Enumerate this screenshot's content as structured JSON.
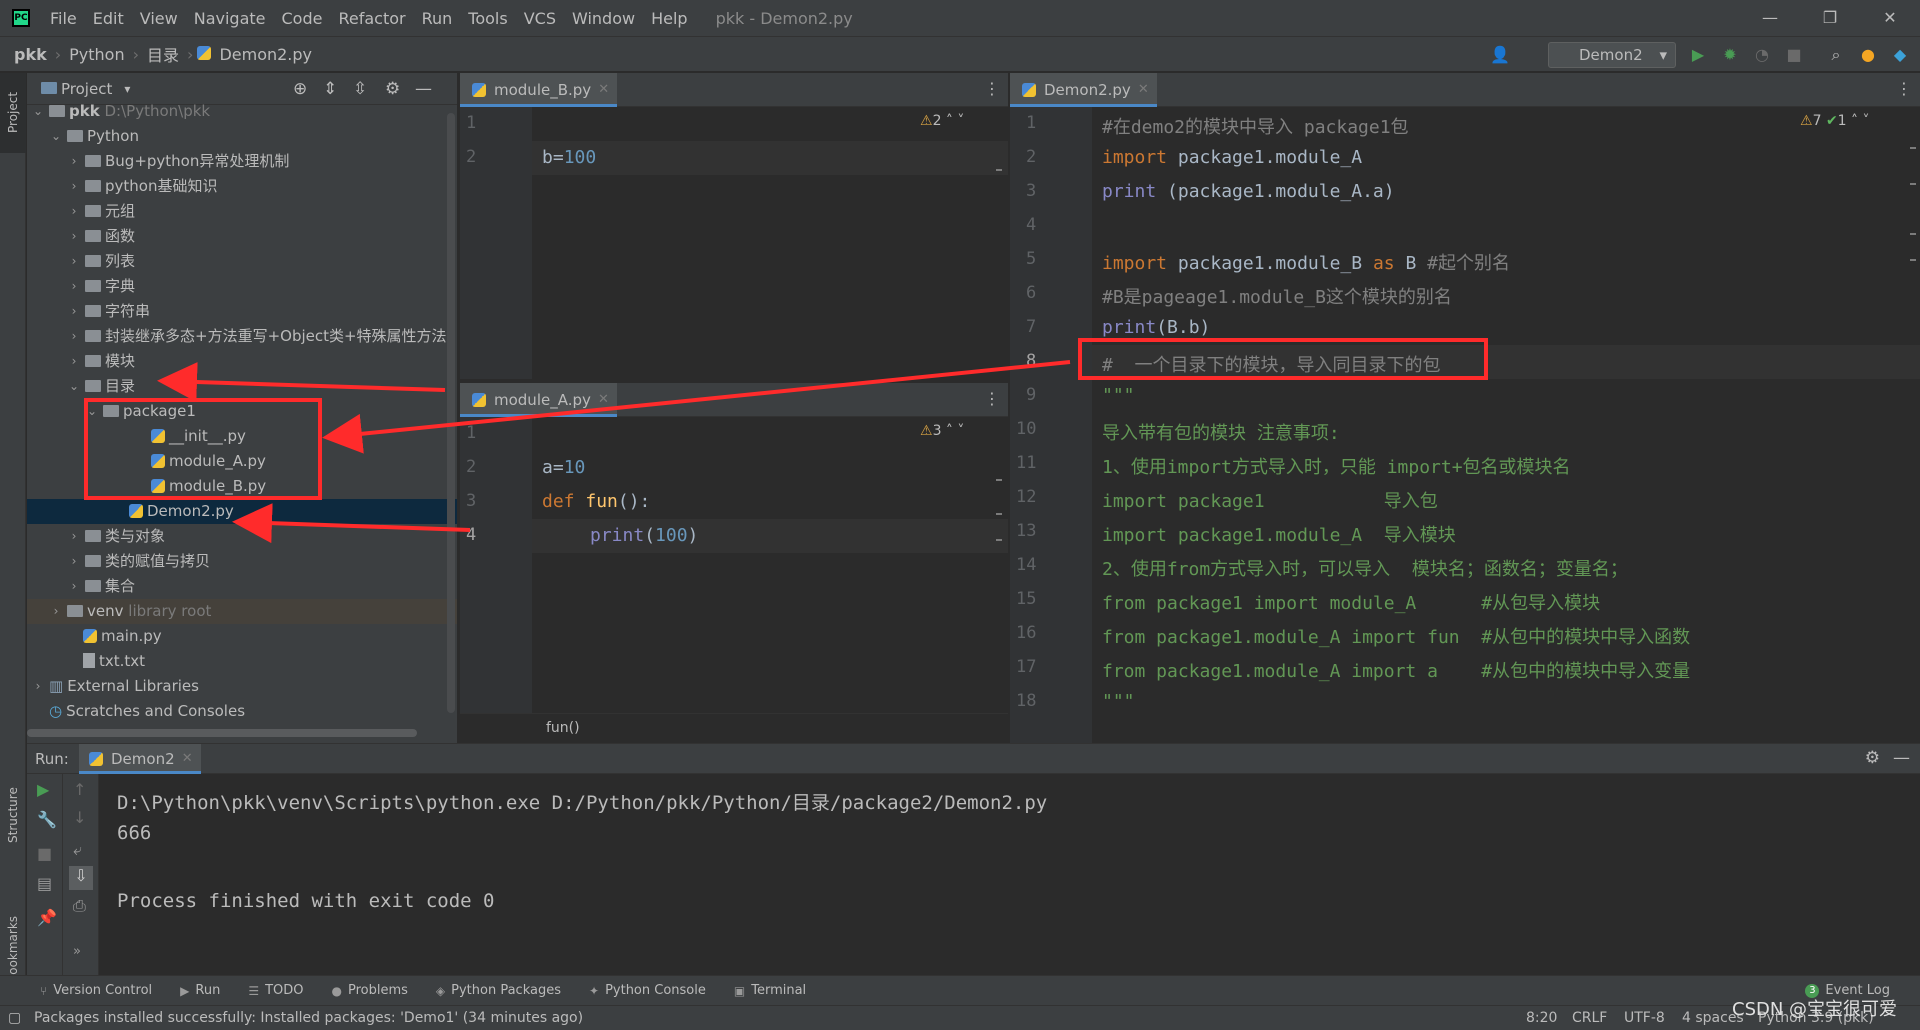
{
  "window": {
    "menu": [
      "File",
      "Edit",
      "View",
      "Navigate",
      "Code",
      "Refactor",
      "Run",
      "Tools",
      "VCS",
      "Window",
      "Help"
    ],
    "title": "pkk - Demon2.py",
    "controls": {
      "minimize": "—",
      "restore": "❐",
      "close": "✕"
    }
  },
  "navbar": {
    "crumbs": [
      "pkk",
      "Python",
      "目录",
      "Demon2.py"
    ],
    "run_config": "Demon2"
  },
  "leftstrip": {
    "project": "Project",
    "structure": "Structure",
    "bookmarks": "Bookmarks"
  },
  "project": {
    "title": "Project",
    "rows": [
      {
        "label": "pkk",
        "extra": "D:\\Python\\pkk"
      },
      {
        "label": "Python"
      },
      {
        "label": "Bug+python异常处理机制"
      },
      {
        "label": "python基础知识"
      },
      {
        "label": "元组"
      },
      {
        "label": "函数"
      },
      {
        "label": "列表"
      },
      {
        "label": "字典"
      },
      {
        "label": "字符串"
      },
      {
        "label": "封装继承多态+方法重写+Object类+特殊属性方法"
      },
      {
        "label": "模块"
      },
      {
        "label": "目录"
      },
      {
        "label": "package1"
      },
      {
        "label": "__init__.py"
      },
      {
        "label": "module_A.py"
      },
      {
        "label": "module_B.py"
      },
      {
        "label": "Demon2.py"
      },
      {
        "label": "类与对象"
      },
      {
        "label": "类的赋值与拷贝"
      },
      {
        "label": "集合"
      },
      {
        "label": "venv",
        "extra": "library root"
      },
      {
        "label": "main.py"
      },
      {
        "label": "txt.txt"
      },
      {
        "label": "External Libraries"
      },
      {
        "label": "Scratches and Consoles"
      }
    ]
  },
  "editor_b": {
    "tab": "module_B.py",
    "warnings": "2",
    "lines": [
      "1",
      "2"
    ],
    "code_b": "b=",
    "code_val": "100"
  },
  "editor_a": {
    "tab": "module_A.py",
    "warnings": "3",
    "lines": [
      "1",
      "2",
      "3",
      "4"
    ],
    "a_var": "a=",
    "a_val": "10",
    "def_kw": "def",
    "fn_name": "fun",
    "fn_rest": "():",
    "print_kw": "print",
    "print_open": "(",
    "print_val": "100",
    "print_close": ")",
    "breadcrumb": "fun()"
  },
  "editor_main": {
    "tab": "Demon2.py",
    "warnings": "7",
    "weak": "1",
    "lines": [
      "1",
      "2",
      "3",
      "4",
      "5",
      "6",
      "7",
      "8",
      "9",
      "10",
      "11",
      "12",
      "13",
      "14",
      "15",
      "16",
      "17",
      "18"
    ],
    "l1": "#在demo2的模块中导入 package1包",
    "l2_kw": "import",
    "l2_rest": " package1.module_A",
    "l3_fn": "print",
    "l3_rest": " (package1.module_A.a)",
    "l5_kw": "import",
    "l5_mid": " package1.module_B ",
    "l5_as": "as",
    "l5_b": " B ",
    "l5_cm": "#起个别名",
    "l6": "#B是pageage1.module_B这个模块的别名",
    "l7_fn": "print",
    "l7_rest": "(B.b)",
    "l8": "#  一个目录下的模块，导入同目录下的包",
    "l9": "\"\"\"",
    "l10": "导入带有包的模块 注意事项:",
    "l11": "1、使用import方式导入时，只能 import+包名或模块名",
    "l12": "import package1           导入包",
    "l13": "import package1.module_A  导入模块",
    "l14": "2、使用from方式导入时，可以导入  模块名；函数名；变量名；",
    "l15": "from package1 import module_A      #从包导入模块",
    "l16": "from package1.module_A import fun  #从包中的模块中导入函数",
    "l17": "from package1.module_A import a    #从包中的模块中导入变量",
    "l18": "\"\"\""
  },
  "run": {
    "label": "Run:",
    "tab": "Demon2",
    "output": [
      "D:\\Python\\pkk\\venv\\Scripts\\python.exe D:/Python/pkk/Python/目录/package2/Demon2.py",
      "666",
      "",
      "Process finished with exit code 0"
    ]
  },
  "toolwindows": [
    "Version Control",
    "Run",
    "TODO",
    "Problems",
    "Python Packages",
    "Python Console",
    "Terminal"
  ],
  "event_log": {
    "count": "3",
    "label": "Event Log"
  },
  "status": {
    "message": "Packages installed successfully: Installed packages: 'Demo1' (34 minutes ago)",
    "position": "8:20",
    "line_sep": "CRLF",
    "encoding": "UTF-8",
    "indent": "4 spaces",
    "interpreter": "Python 3.9 (pkk)",
    "watermark": "CSDN @宝宝很可爱"
  },
  "colors": {
    "annotation": "#ff2b2b",
    "selection": "#0d293e",
    "accent": "#4a88c7"
  }
}
